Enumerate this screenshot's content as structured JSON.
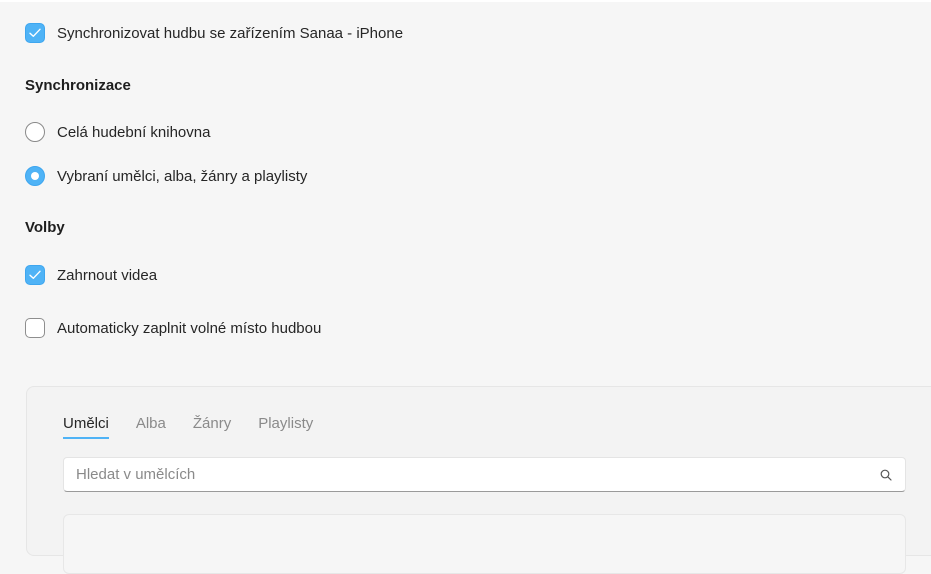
{
  "sync_music": {
    "label": "Synchronizovat hudbu se zařízením Sanaa - iPhone",
    "checked": true
  },
  "sync_section": {
    "title": "Synchronizace",
    "options": [
      {
        "label": "Celá hudební knihovna",
        "selected": false
      },
      {
        "label": "Vybraní umělci, alba, žánry a playlisty",
        "selected": true
      }
    ]
  },
  "options_section": {
    "title": "Volby",
    "include_videos": {
      "label": "Zahrnout videa",
      "checked": true
    },
    "auto_fill": {
      "label": "Automaticky zaplnit volné místo hudbou",
      "checked": false
    }
  },
  "browser": {
    "tabs": [
      {
        "label": "Umělci",
        "active": true
      },
      {
        "label": "Alba",
        "active": false
      },
      {
        "label": "Žánry",
        "active": false
      },
      {
        "label": "Playlisty",
        "active": false
      }
    ],
    "search": {
      "placeholder": "Hledat v umělcích",
      "value": "",
      "icon": "search-icon"
    }
  },
  "colors": {
    "accent": "#4fb3f6",
    "background": "#f6f6f6",
    "text": "#262626"
  }
}
